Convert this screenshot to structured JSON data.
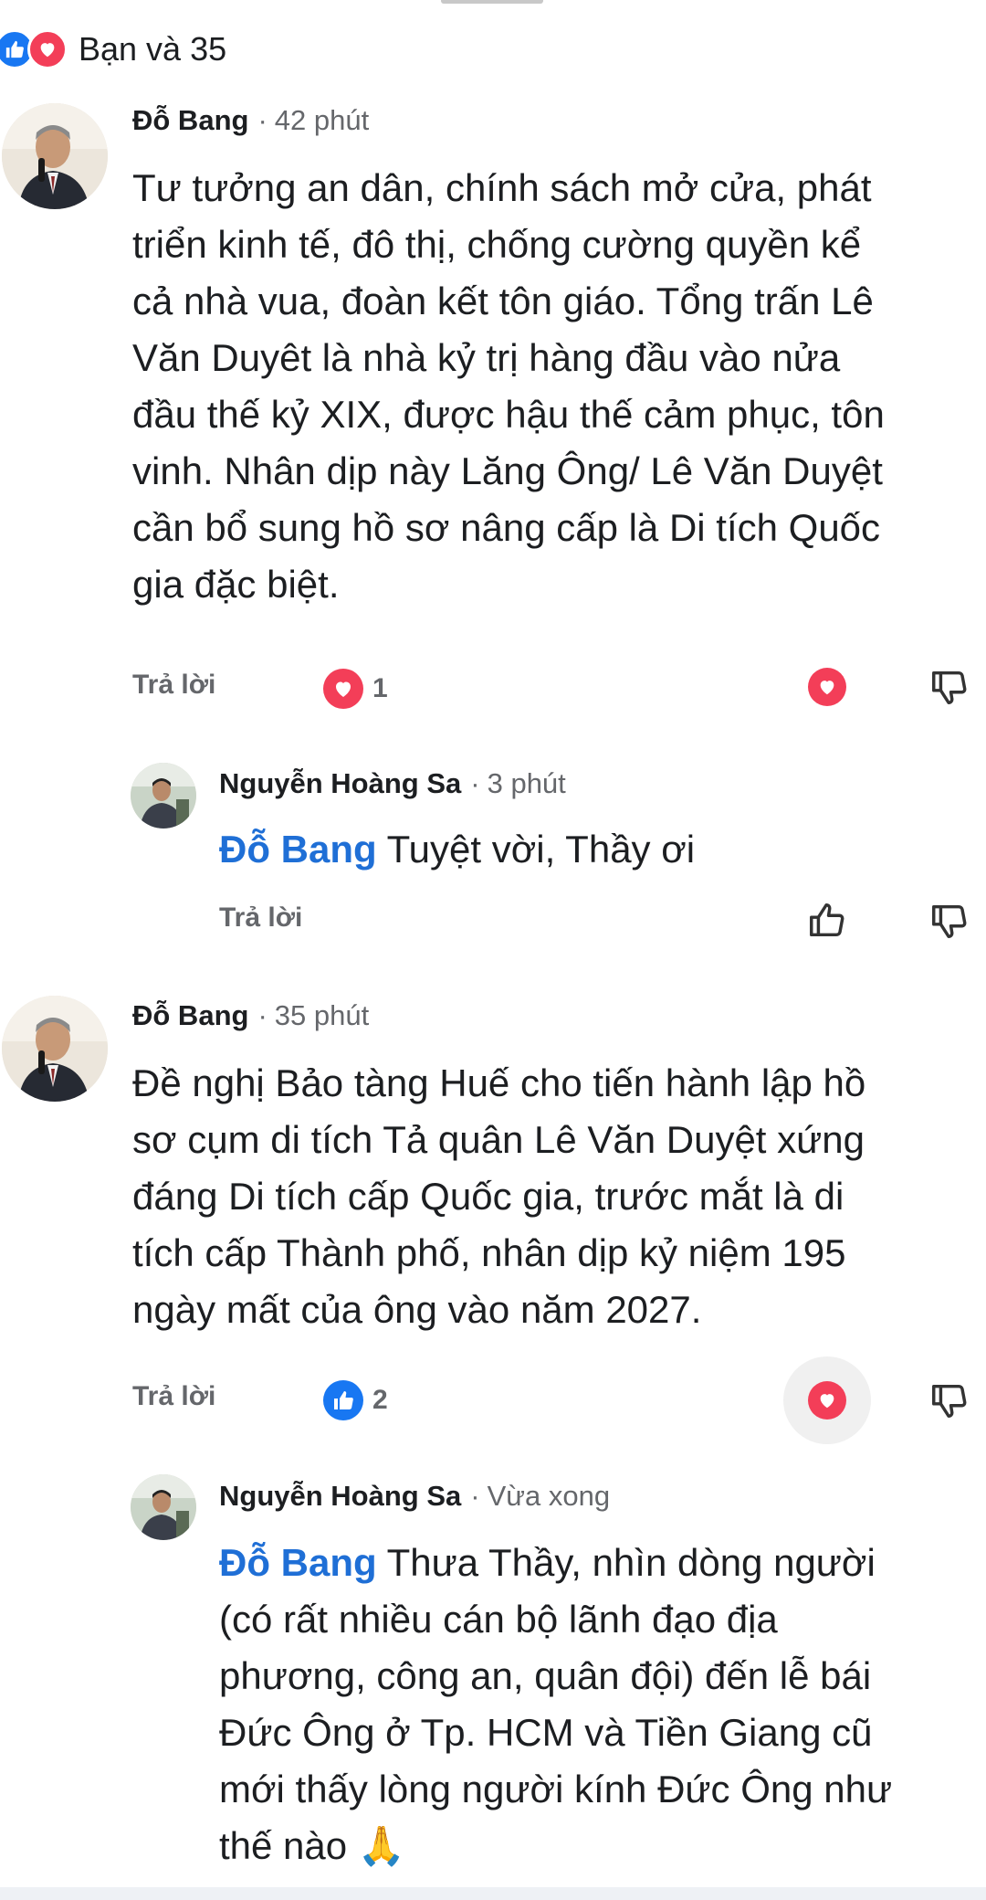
{
  "summary": {
    "text": "Bạn và 35",
    "icons": [
      "like-icon",
      "love-icon"
    ]
  },
  "comments": [
    {
      "author": "Đỗ Bang",
      "time": "42 phút",
      "text": "Tư tưởng an dân, chính sách mở cửa, phát triển kinh tế, đô thị, chống cường quyền kể cả nhà vua, đoàn kết tôn giáo. Tổng trấn Lê Văn Duyêt là nhà kỷ trị hàng đầu vào nửa đầu thế kỷ XIX, được hậu thế cảm phục, tôn vinh. Nhân dịp này Lăng Ông/ Lê Văn Duyệt cần bổ sung hồ sơ nâng cấp là Di tích Quốc gia đặc biệt.",
      "lines": [
        "Tư tưởng an dân, chính sách mở cửa, phát",
        "triển kinh tế, đô thị, chống cường quyền kể",
        "cả nhà vua, đoàn kết tôn giáo. Tổng trấn Lê",
        "Văn Duyêt là nhà kỷ trị hàng đầu vào nửa",
        "đầu thế kỷ XIX, được hậu thế cảm phục, tôn",
        "vinh. Nhân dịp này Lăng Ông/ Lê Văn Duyệt",
        "cần bổ sung hồ sơ nâng cấp là Di tích Quốc",
        "gia đặc biệt."
      ],
      "reply_label": "Trả lời",
      "reaction_icon": "love-icon",
      "reaction_count": "1",
      "reacted": "love"
    },
    {
      "author": "Nguyễn Hoàng Sa",
      "time": "3 phút",
      "mention": "Đỗ Bang",
      "text": "Tuyệt vời, Thầy ơi",
      "reply_label": "Trả lời"
    },
    {
      "author": "Đỗ Bang",
      "time": "35 phút",
      "text": "Đề nghị Bảo tàng Huế cho tiến hành lập hồ sơ cụm di tích Tả quân Lê Văn Duyệt xứng đáng Di tích cấp Quốc gia, trước mắt là di tích cấp Thành phố, nhân dịp kỷ niệm 195 ngày mất của ông vào năm 2027.",
      "lines": [
        "Đề nghị Bảo tàng Huế cho tiến hành lập hồ",
        "sơ cụm di tích Tả quân Lê Văn Duyệt xứng",
        "đáng Di tích cấp Quốc gia, trước mắt là di",
        "tích cấp Thành phố, nhân dịp kỷ niệm 195",
        "ngày mất của ông vào năm 2027."
      ],
      "reply_label": "Trả lời",
      "reaction_icon": "like-icon",
      "reaction_count": "2",
      "reacted": "love"
    },
    {
      "author": "Nguyễn Hoàng Sa",
      "time": "Vừa xong",
      "mention": "Đỗ Bang",
      "text": "Thưa Thầy, nhìn dòng người (có rất nhiều cán bộ lãnh đạo địa phương, công an, quân đội) đến lễ bái Đức Ông ở Tp. HCM và Tiền Giang cũ mới thấy lòng người kính Đức Ông như thế nào 🙏",
      "lines": [
        "Thưa Thầy, nhìn dòng người",
        "(có rất nhiều cán bộ lãnh đạo địa",
        "phương, công an, quân đội) đến lễ bái",
        "Đức Ông ở Tp. HCM và Tiền Giang cũ",
        "mới thấy lòng người kính Đức Ông như",
        "thế nào 🙏"
      ]
    }
  ],
  "colors": {
    "like": "#1877f2",
    "love": "#f33e58",
    "mention": "#1f6fd6",
    "muted": "#65676b"
  }
}
